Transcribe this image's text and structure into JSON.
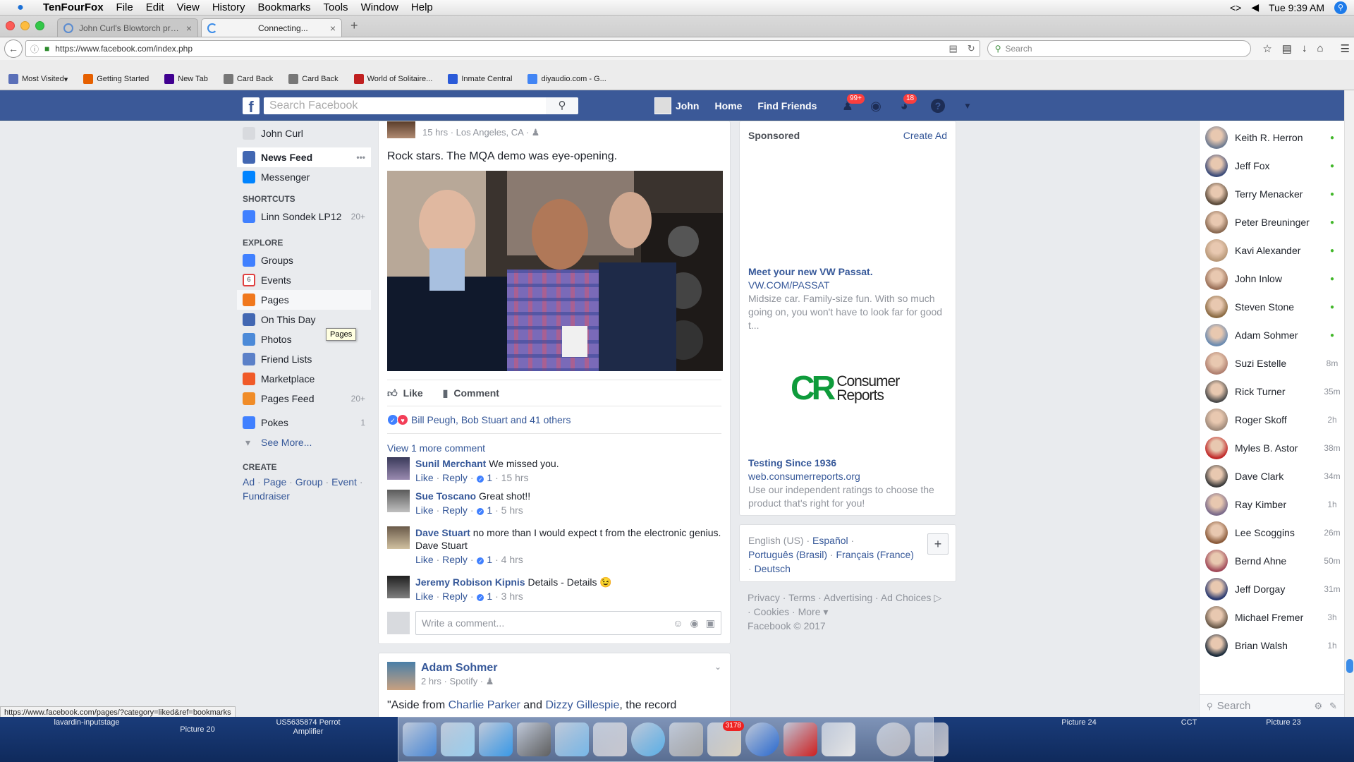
{
  "menubar": {
    "app": "TenFourFox",
    "menus": [
      "File",
      "Edit",
      "View",
      "History",
      "Bookmarks",
      "Tools",
      "Window",
      "Help"
    ],
    "clock": "Tue 9:39 AM"
  },
  "browser": {
    "tabs": [
      {
        "label": "John Curl's Blowtorch prea...",
        "active": false
      },
      {
        "label": "Connecting...",
        "active": true
      }
    ],
    "url": "https://www.facebook.com/index.php",
    "search_placeholder": "Search",
    "bookmarks": [
      {
        "label": "Most Visited",
        "icon": "folder-icon",
        "color": "#5a6fb8"
      },
      {
        "label": "Getting Started",
        "icon": "firefox-icon",
        "color": "#e66000"
      },
      {
        "label": "New Tab",
        "icon": "yahoo-icon",
        "color": "#400090"
      },
      {
        "label": "Card Back",
        "icon": "card-icon",
        "color": "#777777"
      },
      {
        "label": "Card Back",
        "icon": "card-icon",
        "color": "#777777"
      },
      {
        "label": "World of Solitaire...",
        "icon": "solitaire-icon",
        "color": "#c02020"
      },
      {
        "label": "Inmate Central",
        "icon": "a-icon",
        "color": "#2a5ad8"
      },
      {
        "label": "diyaudio.com - G...",
        "icon": "google-icon",
        "color": "#4285f4"
      }
    ],
    "status_url": "https://www.facebook.com/pages/?category=liked&ref=bookmarks"
  },
  "fb": {
    "search_placeholder": "Search Facebook",
    "user": "John",
    "nav": [
      "Home",
      "Find Friends"
    ],
    "badges": {
      "friends": "99+",
      "notifications": "18"
    }
  },
  "leftnav": {
    "profile": "John Curl",
    "top": [
      {
        "label": "News Feed",
        "icon": "news-feed-icon",
        "color": "#4267b2"
      },
      {
        "label": "Messenger",
        "icon": "messenger-icon",
        "color": "#0084ff"
      }
    ],
    "shortcuts_head": "SHORTCUTS",
    "shortcuts": [
      {
        "label": "Linn Sondek LP12",
        "count": "20+",
        "color": "#4080ff"
      }
    ],
    "explore_head": "EXPLORE",
    "explore": [
      {
        "label": "Groups",
        "icon": "groups-icon",
        "color": "#4080ff",
        "count": ""
      },
      {
        "label": "Events",
        "icon": "events-icon",
        "color": "#e04040",
        "count": ""
      },
      {
        "label": "Pages",
        "icon": "pages-icon",
        "color": "#f0781e",
        "count": ""
      },
      {
        "label": "On This Day",
        "icon": "on-this-day-icon",
        "color": "#4267b2",
        "count": ""
      },
      {
        "label": "Photos",
        "icon": "photos-icon",
        "color": "#4c8ad8",
        "count": ""
      },
      {
        "label": "Friend Lists",
        "icon": "friend-lists-icon",
        "color": "#5b80c8",
        "count": ""
      },
      {
        "label": "Marketplace",
        "icon": "marketplace-icon",
        "color": "#f05a28",
        "count": ""
      },
      {
        "label": "Pages Feed",
        "icon": "pages-feed-icon",
        "color": "#f08c28",
        "count": "20+"
      }
    ],
    "pokes": {
      "label": "Pokes",
      "count": "1"
    },
    "see_more": "See More...",
    "create_head": "CREATE",
    "create_links": [
      "Ad",
      "Page",
      "Group",
      "Event",
      "Fundraiser"
    ],
    "tooltip": "Pages",
    "events_day": "6"
  },
  "post": {
    "meta": "15 hrs · Los Angeles, CA ·",
    "text": "Rock stars. The MQA demo was eye-opening.",
    "like": "Like",
    "comment": "Comment",
    "reactions": "Bill Peugh, Bob Stuart and 41 others",
    "more_comments": "View 1 more comment",
    "comments": [
      {
        "name": "Sunil Merchant",
        "text": "We missed you.",
        "likes": "1",
        "time": "15 hrs"
      },
      {
        "name": "Sue Toscano",
        "text": "Great shot!!",
        "likes": "1",
        "time": "5 hrs"
      },
      {
        "name": "Dave Stuart",
        "text": "no more than I would expect t from the electronic genius. Dave Stuart",
        "likes": "1",
        "time": "4 hrs"
      },
      {
        "name": "Jeremy Robison Kipnis",
        "text": "Details - Details 😉",
        "likes": "1",
        "time": "3 hrs"
      }
    ],
    "comment_actions": {
      "like": "Like",
      "reply": "Reply"
    },
    "write_placeholder": "Write a comment..."
  },
  "post2": {
    "name": "Adam Sohmer",
    "meta": "2 hrs · Spotify ·",
    "text_start": "\"Aside from ",
    "link1": "Charlie Parker",
    "text_and": " and ",
    "link2": "Dizzy Gillespie",
    "text_end": ", the record"
  },
  "sponsored": {
    "heading": "Sponsored",
    "create_ad": "Create Ad",
    "ads": [
      {
        "title": "Meet your new VW Passat.",
        "url": "VW.COM/PASSAT",
        "body": "Midsize car. Family-size fun. With so much going on, you won't have to look far for good t..."
      },
      {
        "title": "Testing Since 1936",
        "url": "web.consumerreports.org",
        "body": "Use our independent ratings to choose the product that's right for you!"
      }
    ],
    "cr_logo_mark": "CR",
    "cr_logo_line1": "Consumer",
    "cr_logo_line2": "Reports"
  },
  "languages": {
    "current": "English (US)",
    "others": [
      "Español",
      "Português (Brasil)",
      "Français (France)",
      "Deutsch"
    ]
  },
  "footer": {
    "links": [
      "Privacy",
      "Terms",
      "Advertising",
      "Ad Choices",
      "Cookies",
      "More"
    ],
    "copyright": "Facebook © 2017"
  },
  "chat": {
    "friends": [
      {
        "name": "Keith R. Herron",
        "status": "●",
        "online": true,
        "color": "#6d7a90"
      },
      {
        "name": "Jeff Fox",
        "status": "●",
        "online": true,
        "color": "#3a4a78"
      },
      {
        "name": "Terry Menacker",
        "status": "●",
        "online": true,
        "color": "#5a4a3a"
      },
      {
        "name": "Peter Breuninger",
        "status": "●",
        "online": true,
        "color": "#8a6a52"
      },
      {
        "name": "Kavi Alexander",
        "status": "●",
        "online": true,
        "color": "#b89878"
      },
      {
        "name": "John Inlow",
        "status": "●",
        "online": true,
        "color": "#9a7058"
      },
      {
        "name": "Steven Stone",
        "status": "●",
        "online": true,
        "color": "#8a6a42"
      },
      {
        "name": "Adam Sohmer",
        "status": "●",
        "online": true,
        "color": "#6a8ab0"
      },
      {
        "name": "Suzi Estelle",
        "status": "8m",
        "online": false,
        "color": "#b08070"
      },
      {
        "name": "Rick Turner",
        "status": "35m",
        "online": false,
        "color": "#4a4a4a"
      },
      {
        "name": "Roger Skoff",
        "status": "2h",
        "online": false,
        "color": "#a08a7a"
      },
      {
        "name": "Myles B. Astor",
        "status": "38m",
        "online": false,
        "color": "#c02828"
      },
      {
        "name": "Dave Clark",
        "status": "34m",
        "online": false,
        "color": "#3a3a3a"
      },
      {
        "name": "Ray Kimber",
        "status": "1h",
        "online": false,
        "color": "#7a6a8a"
      },
      {
        "name": "Lee Scoggins",
        "status": "26m",
        "online": false,
        "color": "#8a5a3a"
      },
      {
        "name": "Bernd Ahne",
        "status": "50m",
        "online": false,
        "color": "#a04858"
      },
      {
        "name": "Jeff Dorgay",
        "status": "31m",
        "online": false,
        "color": "#283870"
      },
      {
        "name": "Michael Fremer",
        "status": "3h",
        "online": false,
        "color": "#6a5a4a"
      },
      {
        "name": "Brian Walsh",
        "status": "1h",
        "online": false,
        "color": "#1a2a3a"
      }
    ],
    "search_placeholder": "Search"
  },
  "desktop": {
    "labels": [
      "lavardin-inputstage",
      "Picture 20",
      "US5635874 Perrot Amplifier",
      "Picture 24",
      "CCT",
      "Picture 23"
    ]
  },
  "dock": {
    "mail_badge": "3178",
    "apps": [
      {
        "name": "finder-icon",
        "color": "#4a8ad8"
      },
      {
        "name": "itunes-icon",
        "color": "#9ad0f0"
      },
      {
        "name": "ichat-icon",
        "color": "#3a9ae8"
      },
      {
        "name": "scanner-icon",
        "color": "#606060"
      },
      {
        "name": "folder-icon",
        "color": "#78b8e8"
      },
      {
        "name": "imac-icon",
        "color": "#c8c8d0"
      },
      {
        "name": "safari-icon",
        "color": "#5ab0e8"
      },
      {
        "name": "preview-icon",
        "color": "#a8a8a8"
      },
      {
        "name": "mail-icon",
        "color": "#d8d0c0"
      },
      {
        "name": "globe-icon",
        "color": "#2a6ad0"
      },
      {
        "name": "acrobat-icon",
        "color": "#d02020"
      },
      {
        "name": "textedit-icon",
        "color": "#e8e8e8"
      },
      {
        "name": "at-sign-icon",
        "color": "#b8b8c0"
      },
      {
        "name": "trash-icon",
        "color": "#c0c0c8"
      }
    ]
  }
}
